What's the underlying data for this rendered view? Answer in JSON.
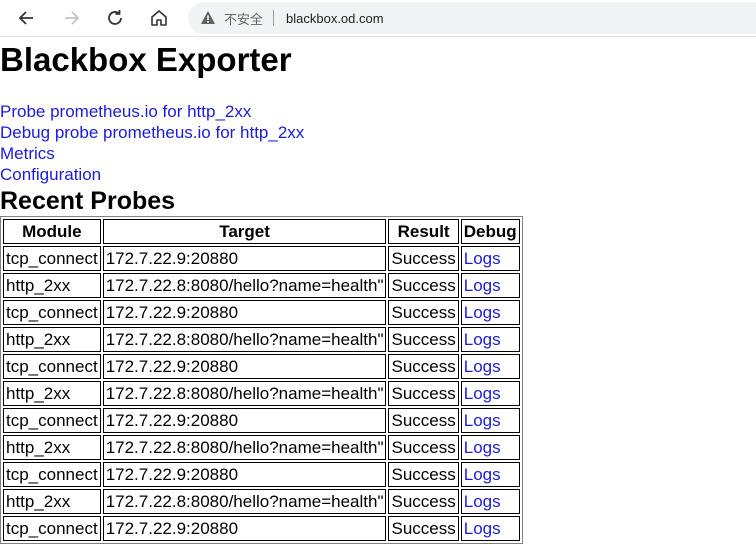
{
  "browser": {
    "security_label": "不安全",
    "url": "blackbox.od.com"
  },
  "page": {
    "title": "Blackbox Exporter",
    "links": [
      "Probe prometheus.io for http_2xx",
      "Debug probe prometheus.io for http_2xx",
      "Metrics",
      "Configuration"
    ],
    "recent_probes_heading": "Recent Probes"
  },
  "table": {
    "headers": [
      "Module",
      "Target",
      "Result",
      "Debug"
    ],
    "rows": [
      [
        "tcp_connect",
        "172.7.22.9:20880",
        "Success",
        "Logs"
      ],
      [
        "http_2xx",
        "172.7.22.8:8080/hello?name=health\"",
        "Success",
        "Logs"
      ],
      [
        "tcp_connect",
        "172.7.22.9:20880",
        "Success",
        "Logs"
      ],
      [
        "http_2xx",
        "172.7.22.8:8080/hello?name=health\"",
        "Success",
        "Logs"
      ],
      [
        "tcp_connect",
        "172.7.22.9:20880",
        "Success",
        "Logs"
      ],
      [
        "http_2xx",
        "172.7.22.8:8080/hello?name=health\"",
        "Success",
        "Logs"
      ],
      [
        "tcp_connect",
        "172.7.22.9:20880",
        "Success",
        "Logs"
      ],
      [
        "http_2xx",
        "172.7.22.8:8080/hello?name=health\"",
        "Success",
        "Logs"
      ],
      [
        "tcp_connect",
        "172.7.22.9:20880",
        "Success",
        "Logs"
      ],
      [
        "http_2xx",
        "172.7.22.8:8080/hello?name=health\"",
        "Success",
        "Logs"
      ],
      [
        "tcp_connect",
        "172.7.22.9:20880",
        "Success",
        "Logs"
      ]
    ]
  },
  "colors": {
    "link": "#1c1cd8",
    "toolbar_bg": "#ffffff",
    "address_bg": "#f1f3f4"
  },
  "icons": [
    "back-icon",
    "forward-icon",
    "reload-icon",
    "home-icon",
    "warning-icon"
  ]
}
